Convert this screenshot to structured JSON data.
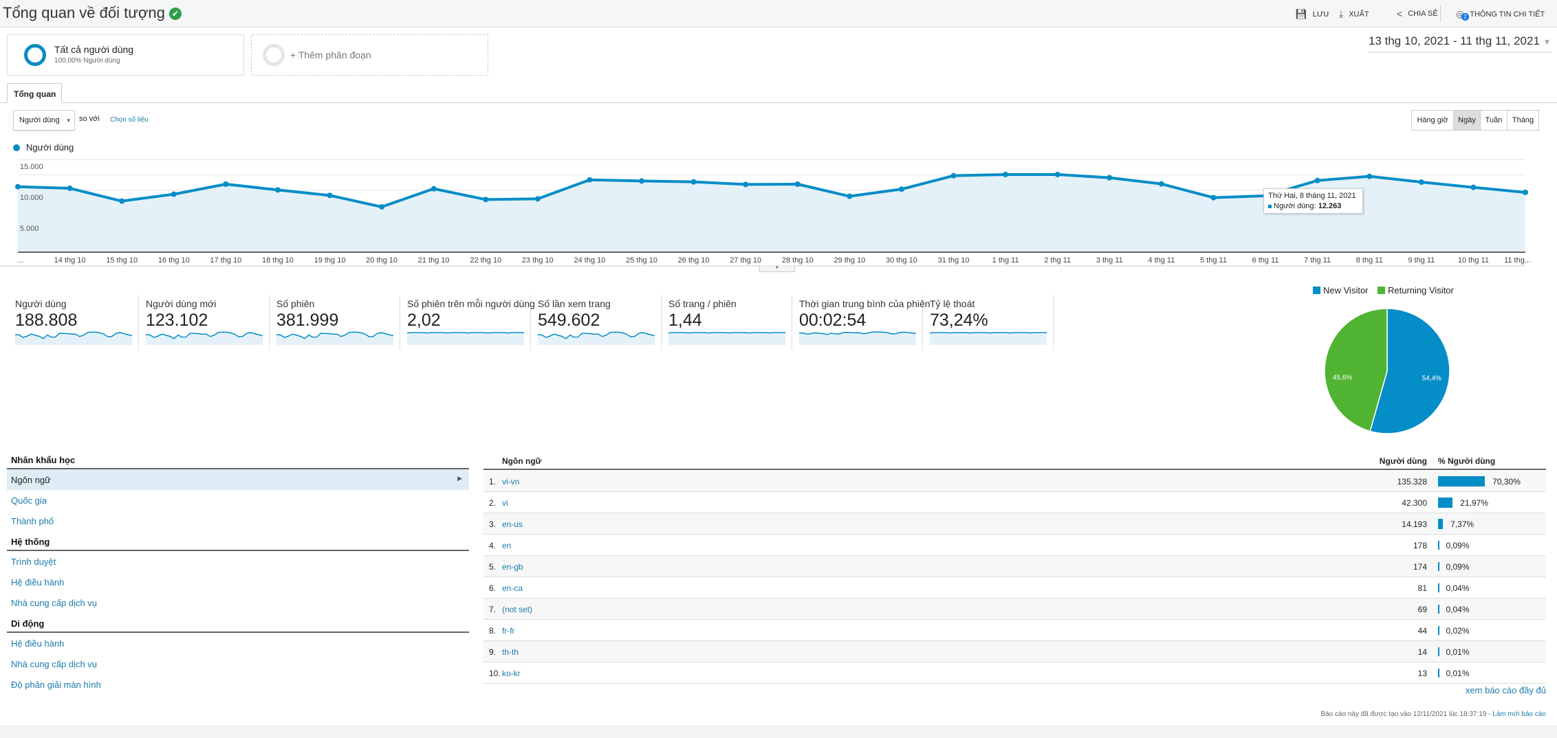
{
  "header": {
    "title": "Tổng quan về đối tượng",
    "save": "LƯU",
    "export": "XUẤT",
    "share": "CHIA SẺ",
    "insights": "THÔNG TIN CHI TIẾT",
    "insights_badge": "2"
  },
  "segments": {
    "all_users": "Tất cả người dùng",
    "all_users_sub": "100,00% Người dùng",
    "add_segment": "+ Thêm phân đoạn"
  },
  "date_range": "13 thg 10, 2021 - 11 thg 11, 2021",
  "tabs": [
    {
      "label": "Tổng quan"
    }
  ],
  "controls": {
    "metric": "Người dùng",
    "compare": "so với",
    "choose": "Chọn số liệu",
    "granularity": [
      "Hàng giờ",
      "Ngày",
      "Tuần",
      "Tháng"
    ],
    "selected": "Ngày"
  },
  "chart_data": {
    "type": "area",
    "legend": "Người dùng",
    "color": "#058dc7",
    "y_ticks": [
      "15.000",
      "10.000",
      "5.000"
    ],
    "ylim": [
      0,
      15000
    ],
    "x_labels": [
      "...",
      "14 thg 10",
      "15 thg 10",
      "16 thg 10",
      "17 thg 10",
      "18 thg 10",
      "19 thg 10",
      "20 thg 10",
      "21 thg 10",
      "22 thg 10",
      "23 thg 10",
      "24 thg 10",
      "25 thg 10",
      "26 thg 10",
      "27 thg 10",
      "28 thg 10",
      "29 thg 10",
      "30 thg 10",
      "31 thg 10",
      "1 thg 11",
      "2 thg 11",
      "3 thg 11",
      "4 thg 11",
      "5 thg 11",
      "6 thg 11",
      "7 thg 11",
      "8 thg 11",
      "9 thg 11",
      "10 thg 11",
      "11 thg..."
    ],
    "values": [
      10590,
      10330,
      8260,
      9370,
      11000,
      10070,
      9180,
      7330,
      10260,
      8520,
      8630,
      11700,
      11520,
      11370,
      10960,
      11000,
      9040,
      10190,
      12370,
      12560,
      12560,
      12040,
      11040,
      8820,
      9110,
      11590,
      12263,
      11330,
      10480,
      9670
    ],
    "tooltip": {
      "title": "Thứ Hai, 8 tháng 11, 2021",
      "label": "Người dùng:",
      "value": "12.263"
    }
  },
  "metrics": [
    {
      "label": "Người dùng",
      "value": "188.808"
    },
    {
      "label": "Người dùng mới",
      "value": "123.102"
    },
    {
      "label": "Số phiên",
      "value": "381.999"
    },
    {
      "label": "Số phiên trên mỗi người dùng",
      "value": "2,02"
    },
    {
      "label": "Số lần xem trang",
      "value": "549.602"
    },
    {
      "label": "Số trang / phiên",
      "value": "1,44"
    },
    {
      "label": "Thời gian trung bình của phiên",
      "value": "00:02:54"
    },
    {
      "label": "Tỷ lệ thoát",
      "value": "73,24%"
    }
  ],
  "pie": {
    "slices": [
      {
        "name": "New Visitor",
        "value": 54.4,
        "label": "54,4%",
        "color": "#058dc7"
      },
      {
        "name": "Returning Visitor",
        "value": 45.6,
        "label": "45,6%",
        "color": "#50b432"
      }
    ]
  },
  "nav": {
    "sections": [
      {
        "title": "Nhân khẩu học",
        "items": [
          "Ngôn ngữ",
          "Quốc gia",
          "Thành phố"
        ]
      },
      {
        "title": "Hệ thống",
        "items": [
          "Trình duyệt",
          "Hệ điều hành",
          "Nhà cung cấp dịch vụ"
        ]
      },
      {
        "title": "Di động",
        "items": [
          "Hệ điều hành",
          "Nhà cung cấp dịch vụ",
          "Độ phân giải màn hình"
        ]
      }
    ]
  },
  "table": {
    "headers": [
      "Ngôn ngữ",
      "Người dùng",
      "% Người dùng"
    ],
    "rows": [
      {
        "idx": "1.",
        "lang": "vi-vn",
        "users": "135.328",
        "pct": "70,30%",
        "p": 70.3
      },
      {
        "idx": "2.",
        "lang": "vi",
        "users": "42.300",
        "pct": "21,97%",
        "p": 21.97
      },
      {
        "idx": "3.",
        "lang": "en-us",
        "users": "14.193",
        "pct": "7,37%",
        "p": 7.37
      },
      {
        "idx": "4.",
        "lang": "en",
        "users": "178",
        "pct": "0,09%",
        "p": 0.09
      },
      {
        "idx": "5.",
        "lang": "en-gb",
        "users": "174",
        "pct": "0,09%",
        "p": 0.09
      },
      {
        "idx": "6.",
        "lang": "en-ca",
        "users": "81",
        "pct": "0,04%",
        "p": 0.04
      },
      {
        "idx": "7.",
        "lang": "(not set)",
        "users": "69",
        "pct": "0,04%",
        "p": 0.04
      },
      {
        "idx": "8.",
        "lang": "fr-fr",
        "users": "44",
        "pct": "0,02%",
        "p": 0.02
      },
      {
        "idx": "9.",
        "lang": "th-th",
        "users": "14",
        "pct": "0,01%",
        "p": 0.01
      },
      {
        "idx": "10.",
        "lang": "ko-kr",
        "users": "13",
        "pct": "0,01%",
        "p": 0.01
      }
    ],
    "full_report": "xem báo cáo đầy đủ"
  },
  "footer": {
    "generated": "Báo cáo này đã được tạo vào 12/11/2021 lúc 18:37:19 -",
    "refresh": "Làm mới báo cáo"
  }
}
